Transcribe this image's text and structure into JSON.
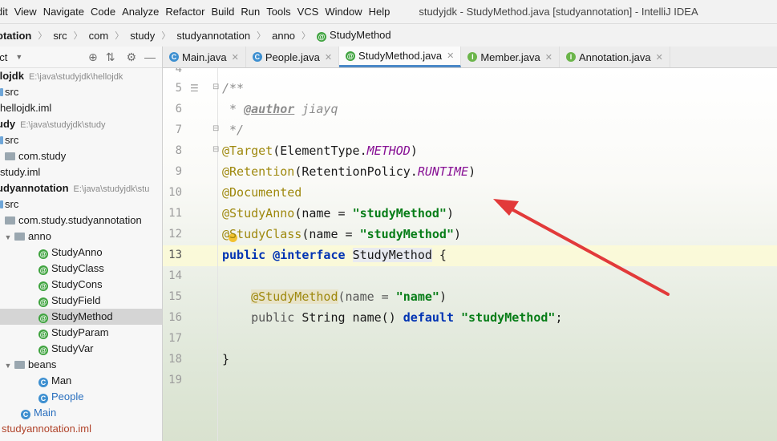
{
  "menubar": {
    "items": [
      "dit",
      "View",
      "Navigate",
      "Code",
      "Analyze",
      "Refactor",
      "Build",
      "Run",
      "Tools",
      "VCS",
      "Window",
      "Help"
    ],
    "window_title": "studyjdk - StudyMethod.java [studyannotation] - IntelliJ IDEA"
  },
  "breadcrumb": {
    "items": [
      "otation",
      "src",
      "com",
      "study",
      "studyannotation",
      "anno",
      "StudyMethod"
    ]
  },
  "sidebar": {
    "toolbar_label": "ect",
    "tree": [
      {
        "label": "llojdk",
        "path": "E:\\java\\studyjdk\\hellojdk",
        "kind": "module",
        "bold": true
      },
      {
        "label": "src",
        "kind": "src-folder"
      },
      {
        "label": "hellojdk.iml",
        "kind": "file"
      },
      {
        "label": "udy",
        "path": "E:\\java\\studyjdk\\study",
        "kind": "module",
        "bold": true
      },
      {
        "label": "src",
        "kind": "src-folder"
      },
      {
        "label": "com.study",
        "kind": "package"
      },
      {
        "label": "study.iml",
        "kind": "file"
      },
      {
        "label": "udyannotation",
        "path": "E:\\java\\studyjdk\\stu",
        "kind": "module",
        "bold": true
      },
      {
        "label": "src",
        "kind": "src-folder"
      },
      {
        "label": "com.study.studyannotation",
        "kind": "package"
      },
      {
        "label": "anno",
        "kind": "package"
      },
      {
        "label": "StudyAnno",
        "kind": "annotation"
      },
      {
        "label": "StudyClass",
        "kind": "annotation"
      },
      {
        "label": "StudyCons",
        "kind": "annotation"
      },
      {
        "label": "StudyField",
        "kind": "annotation"
      },
      {
        "label": "StudyMethod",
        "kind": "annotation",
        "selected": true
      },
      {
        "label": "StudyParam",
        "kind": "annotation"
      },
      {
        "label": "StudyVar",
        "kind": "annotation"
      },
      {
        "label": "beans",
        "kind": "package"
      },
      {
        "label": "Man",
        "kind": "class"
      },
      {
        "label": "People",
        "kind": "class"
      },
      {
        "label": "Main",
        "kind": "class"
      },
      {
        "label": "studyannotation.iml",
        "kind": "file"
      }
    ]
  },
  "tabs": [
    {
      "label": "Main.java",
      "icon": "class-icon"
    },
    {
      "label": "People.java",
      "icon": "class-icon"
    },
    {
      "label": "StudyMethod.java",
      "icon": "annotation-icon",
      "active": true
    },
    {
      "label": "Member.java",
      "icon": "interface-icon"
    },
    {
      "label": "Annotation.java",
      "icon": "interface-icon"
    }
  ],
  "editor": {
    "line_numbers": [
      "4",
      "5",
      "6",
      "7",
      "8",
      "9",
      "10",
      "11",
      "12",
      "13",
      "14",
      "15",
      "16",
      "17",
      "18",
      "19"
    ],
    "current_line": "13",
    "lines": {
      "l5": "/**",
      "l6_star": " * ",
      "l6_tag": "@author",
      "l6_name": " jiayq",
      "l7": " */",
      "l8_ann": "@Target",
      "l8_mid": "(ElementType.",
      "l8_const": "METHOD",
      "l8_end": ")",
      "l9_ann": "@Retention",
      "l9_mid": "(RetentionPolicy.",
      "l9_const": "RUNTIME",
      "l9_end": ")",
      "l10_ann": "@Documented",
      "l11_ann": "@StudyAnno",
      "l11_mid": "(name = ",
      "l11_str": "\"studyMethod\"",
      "l11_end": ")",
      "l12_ann": "@StudyClass",
      "l12_mid": "(name = ",
      "l12_str": "\"studyMethod\"",
      "l12_end": ")",
      "l13_kw1": "public",
      "l13_kw2": "@interface",
      "l13_name": "StudyMethod",
      "l13_end": " {",
      "l15_ann": "@StudyMethod",
      "l15_mid": "(name = ",
      "l15_str": "\"name\"",
      "l15_end": ")",
      "l16_kw1": "public",
      "l16_mid": " String name() ",
      "l16_kw2": "default",
      "l16_str": "\"studyMethod\"",
      "l16_end": ";",
      "l18": "}"
    }
  },
  "colors": {
    "annotation": "#9e880d",
    "keyword": "#0033b3",
    "string": "#067d17",
    "constant": "#871094",
    "arrow": "#e23a3a"
  }
}
